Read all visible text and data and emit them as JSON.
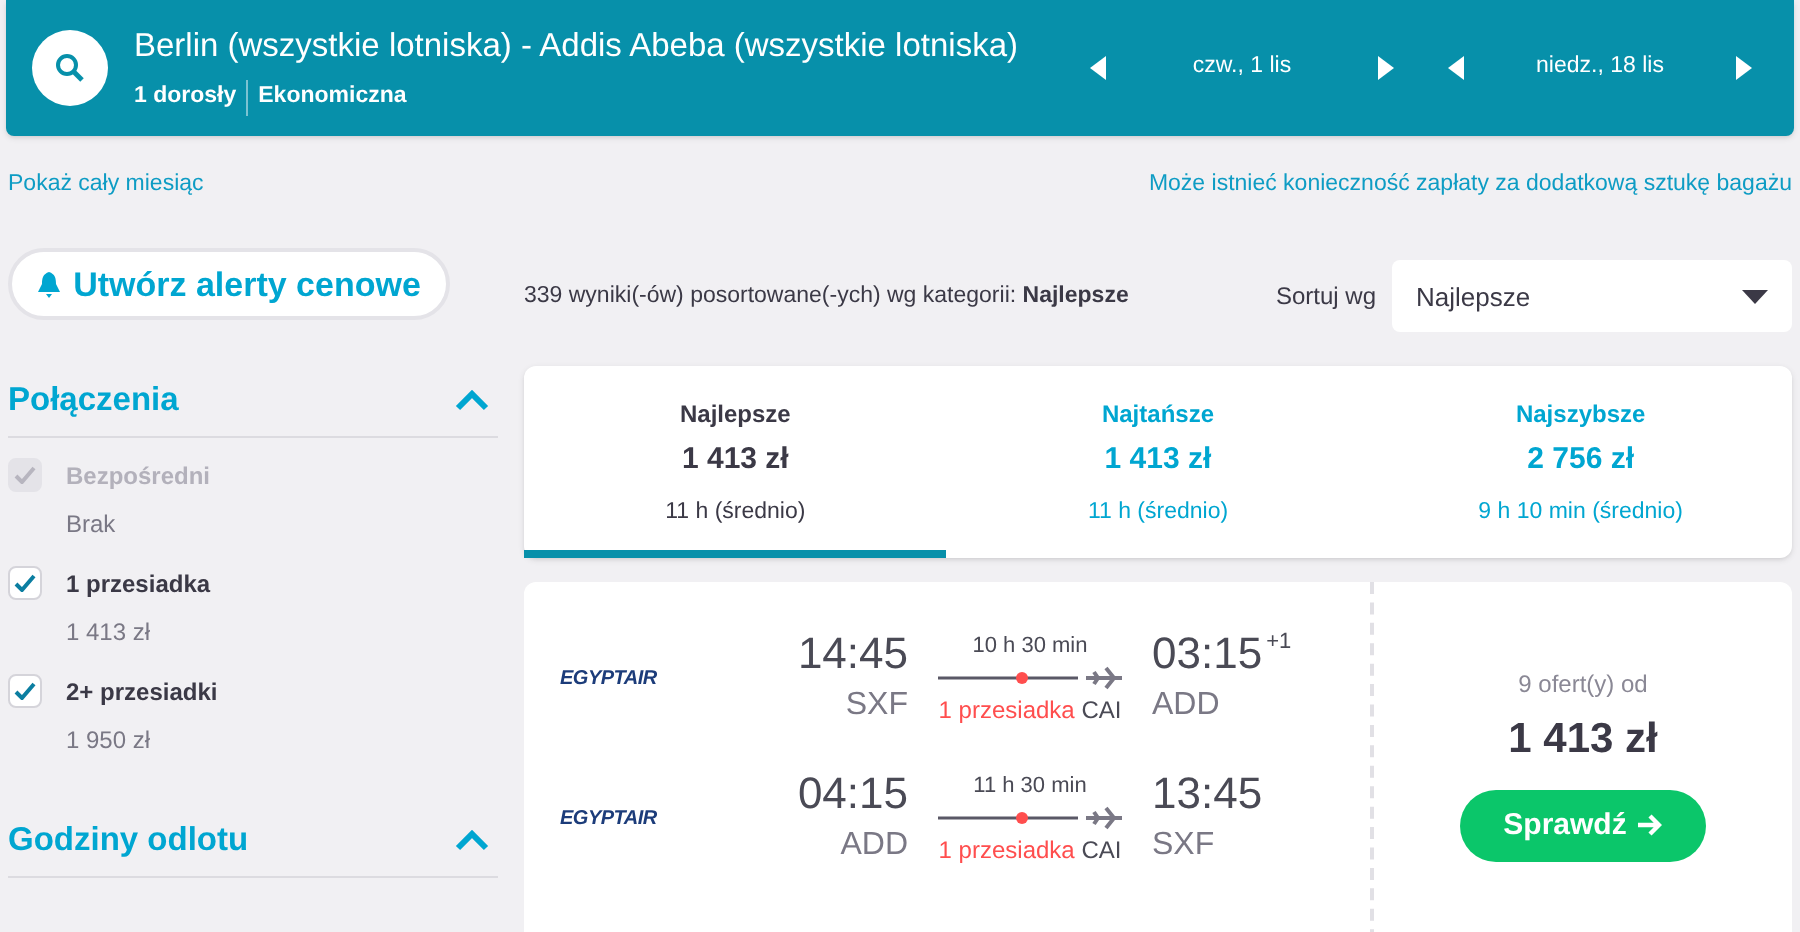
{
  "search_bar": {
    "route": "Berlin (wszystkie lotniska) - Addis Abeba (wszystkie lotniska)",
    "passengers": "1 dorosły",
    "cabin": "Ekonomiczna",
    "dates": [
      "czw., 1 lis",
      "niedz., 18 lis"
    ]
  },
  "links": {
    "month": "Pokaż cały miesiąc",
    "baggage": "Może istnieć konieczność zapłaty za dodatkową sztukę bagażu"
  },
  "alert_button": "Utwórz alerty cenowe",
  "filters": [
    {
      "title": "Połączenia",
      "expanded": true,
      "options": [
        {
          "label": "Bezpośredni",
          "price": "Brak",
          "checked": true,
          "disabled": true
        },
        {
          "label": "1 przesiadka",
          "price": "1 413 zł",
          "checked": true,
          "disabled": false
        },
        {
          "label": "2+ przesiadki",
          "price": "1 950 zł",
          "checked": true,
          "disabled": false
        }
      ]
    },
    {
      "title": "Godziny odlotu",
      "expanded": true
    }
  ],
  "results_summary": {
    "text": "339 wyniki(-ów) posortowane(-ych) wg kategorii:",
    "category": "Najlepsze"
  },
  "sort": {
    "label": "Sortuj wg",
    "value": "Najlepsze"
  },
  "sort_tabs": [
    {
      "label": "Najlepsze",
      "price": "1 413 zł",
      "duration": "11 h (średnio)",
      "selected": true
    },
    {
      "label": "Najtańsze",
      "price": "1 413 zł",
      "duration": "11 h (średnio)",
      "selected": false
    },
    {
      "label": "Najszybsze",
      "price": "2 756 zł",
      "duration": "9 h 10 min (średnio)",
      "selected": false
    }
  ],
  "result": {
    "legs": [
      {
        "airline": "EGYPTAIR",
        "depart": "14:45",
        "from": "SXF",
        "duration": "10 h 30 min",
        "stops": "1 przesiadka",
        "via": "CAI",
        "arrive": "03:15",
        "day_offset": "+1",
        "to": "ADD"
      },
      {
        "airline": "EGYPTAIR",
        "depart": "04:15",
        "from": "ADD",
        "duration": "11 h 30 min",
        "stops": "1 przesiadka",
        "via": "CAI",
        "arrive": "13:45",
        "to": "SXF"
      }
    ],
    "offers": "9 ofert(y) od",
    "price": "1 413 zł",
    "button": "Sprawdź"
  }
}
